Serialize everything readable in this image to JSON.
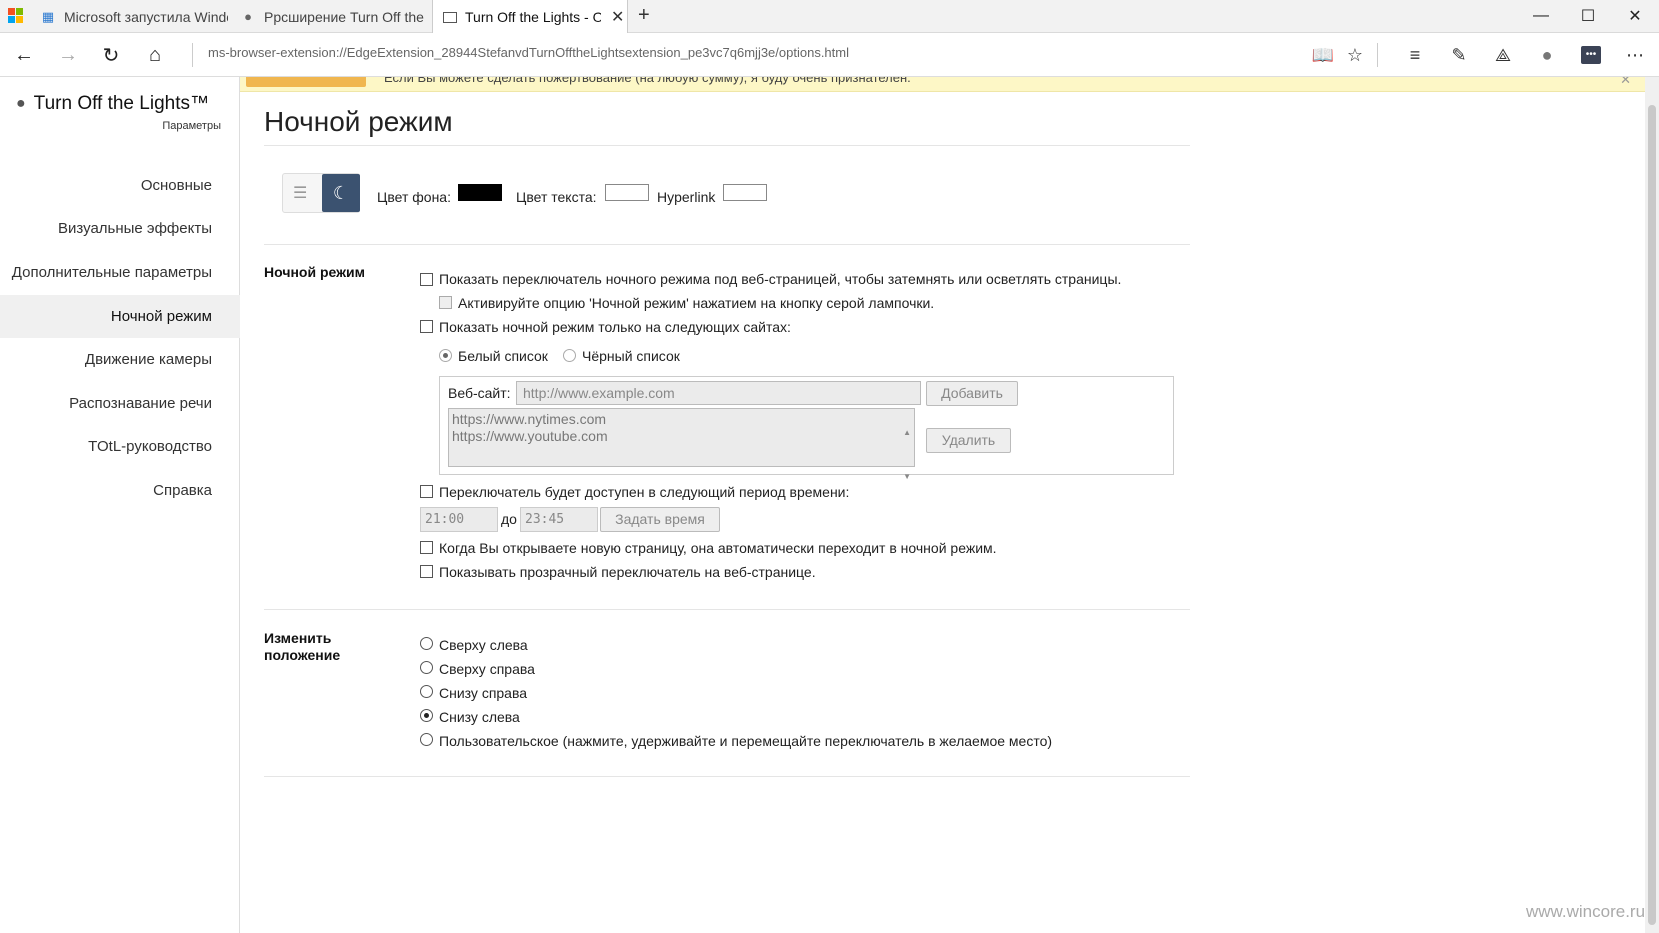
{
  "browser": {
    "tabs": [
      {
        "title": "Microsoft запустила Windo",
        "icon": "windows-grid-icon"
      },
      {
        "title": "Ррсширение Turn Off the Lig",
        "icon": "lightbulb-icon"
      },
      {
        "title": "Turn Off the Lights - Or",
        "icon": "page-icon",
        "active": true
      }
    ],
    "new_tab": "+",
    "url": "ms-browser-extension://EdgeExtension_28944StefanvdTurnOfftheLightsextension_pe3vc7q6mjj3e/options.html"
  },
  "sidebar": {
    "brand": "Turn Off the Lights™",
    "subtitle": "Параметры",
    "items": [
      {
        "label": "Основные"
      },
      {
        "label": "Визуальные эффекты"
      },
      {
        "label": "Дополнительные параметры"
      },
      {
        "label": "Ночной режим",
        "active": true
      },
      {
        "label": "Движение камеры"
      },
      {
        "label": "Распознавание речи"
      },
      {
        "label": "TOtL-руководство"
      },
      {
        "label": "Справка"
      }
    ]
  },
  "banner": {
    "text": "Если Вы можете сделать пожертвование (на любую сумму), я буду очень признателен."
  },
  "main": {
    "title": "Ночной режим",
    "colors": {
      "bg_label": "Цвет фона:",
      "bg_value": "#000000",
      "text_label": "Цвет текста:",
      "text_value": "#ffffff",
      "link_label": "Hyperlink",
      "link_value": "#ffffff"
    },
    "night": {
      "label": "Ночной режим",
      "opt_show_switch": "Показать переключатель ночного режима под веб-страницей, чтобы затемнять или осветлять страницы.",
      "opt_activate_bulb": "Активируйте опцию 'Ночной режим' нажатием на кнопку серой лампочки.",
      "opt_only_sites": "Показать ночной режим только на следующих сайтах:",
      "whitelist": "Белый список",
      "blacklist": "Чёрный список",
      "website_label": "Веб-сайт:",
      "website_placeholder": "http://www.example.com",
      "add_button": "Добавить",
      "sites": [
        "https://www.nytimes.com",
        "https://www.youtube.com"
      ],
      "delete_button": "Удалить",
      "opt_time": "Переключатель будет доступен в следующий период времени:",
      "time_from": "21:00",
      "time_sep": "до",
      "time_to": "23:45",
      "set_time_button": "Задать время",
      "opt_auto_new_page": "Когда Вы открываете новую страницу, она автоматически переходит в ночной режим.",
      "opt_transparent": "Показывать прозрачный переключатель на веб-странице."
    },
    "position": {
      "label": "Изменить положение",
      "options": [
        {
          "label": "Сверху слева",
          "checked": false
        },
        {
          "label": "Сверху справа",
          "checked": false
        },
        {
          "label": "Снизу справа",
          "checked": false
        },
        {
          "label": "Снизу слева",
          "checked": true
        },
        {
          "label": "Пользовательское (нажмите, удерживайте и перемещайте переключатель в желаемое место)",
          "checked": false
        }
      ]
    }
  },
  "watermark": "www.wincore.ru"
}
